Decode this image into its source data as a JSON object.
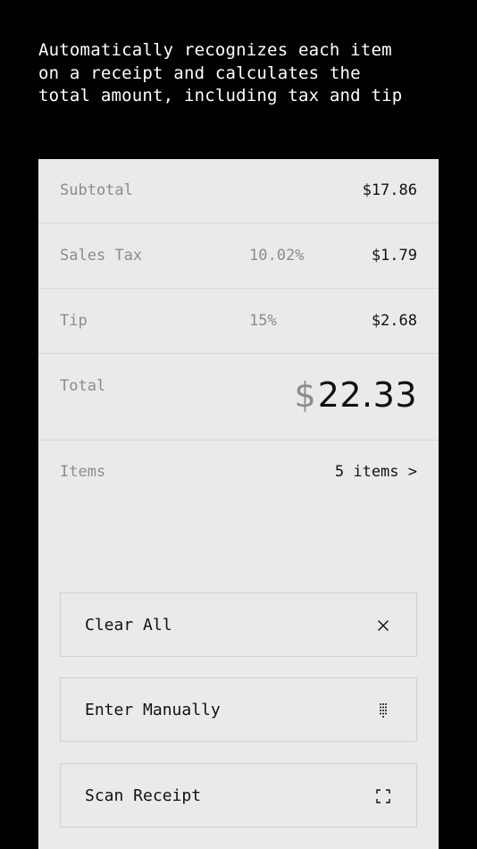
{
  "headline": "Automatically recognizes each item\non a receipt and calculates the\ntotal amount, including tax and tip",
  "summary": {
    "subtotal": {
      "label": "Subtotal",
      "amount": "$17.86"
    },
    "sales_tax": {
      "label": "Sales Tax",
      "rate": "10.02%",
      "amount": "$1.79"
    },
    "tip": {
      "label": "Tip",
      "rate": "15%",
      "amount": "$2.68"
    },
    "total": {
      "label": "Total",
      "currency": "$",
      "amount": "22.33"
    },
    "items": {
      "label": "Items",
      "value": "5 items >"
    }
  },
  "actions": {
    "clear": {
      "label": "Clear All",
      "icon": "close-icon"
    },
    "manual": {
      "label": "Enter Manually",
      "icon": "keypad-icon"
    },
    "scan": {
      "label": "Scan Receipt",
      "icon": "scan-frame-icon"
    }
  },
  "colors": {
    "background": "#000000",
    "card": "#eaeaea",
    "muted_text": "#8c8c8c",
    "primary_text": "#111111"
  }
}
